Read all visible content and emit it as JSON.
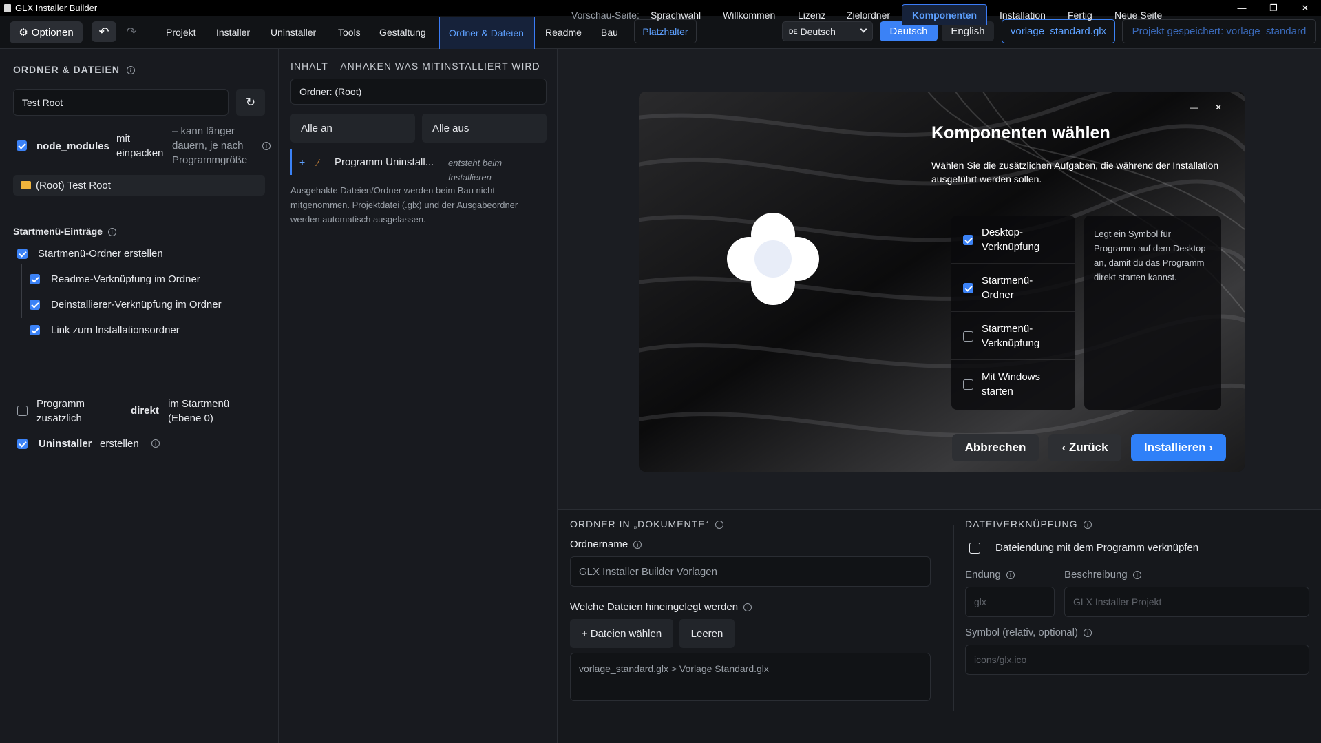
{
  "window": {
    "title": "GLX Installer Builder",
    "minimize": "—",
    "maximize": "❐",
    "close": "✕"
  },
  "toolbar": {
    "options_label": "Optionen",
    "undo": "↶",
    "redo": "↷",
    "menu": [
      "Projekt",
      "Installer",
      "Uninstaller",
      "Tools",
      "Gestaltung",
      "Ordner & Dateien",
      "Readme",
      "Bau"
    ],
    "placeholder_btn": "Platzhalter",
    "lang_select": {
      "flag": "DE",
      "value": "Deutsch"
    },
    "lang_de": "Deutsch",
    "lang_en": "English",
    "project_file": "vorlage_standard.glx",
    "saved_status": "Projekt gespeichert: vorlage_standard"
  },
  "folders": {
    "title": "ORDNER & DATEIEN",
    "root_name": "Test Root",
    "refresh": "↻",
    "node_modules": {
      "checked": true,
      "name": "node_modules",
      "suffix": "mit einpacken",
      "hint": "– kann länger dauern, je nach Programmgröße"
    },
    "tree_item": "(Root) Test Root",
    "startmenu": {
      "title": "Startmenü-Einträge",
      "create_folder": {
        "checked": true,
        "label": "Startmenü-Ordner erstellen"
      },
      "readme_link": {
        "checked": true,
        "label": "Readme-Verknüpfung im Ordner"
      },
      "uninstaller_link": {
        "checked": true,
        "label": "Deinstallierer-Verknüpfung im Ordner"
      },
      "install_link": {
        "checked": true,
        "label": "Link zum Installationsordner"
      },
      "direct": {
        "checked": false,
        "pre": "Programm zusätzlich",
        "bold": "direkt",
        "post": "im Startmenü (Ebene 0)"
      },
      "uninstaller": {
        "checked": true,
        "bold": "Uninstaller",
        "post": "erstellen"
      }
    }
  },
  "content": {
    "title": "INHALT – ANHAKEN WAS MITINSTALLIERT WIRD",
    "folder_label": "Ordner: (Root)",
    "all_on": "Alle an",
    "all_off": "Alle aus",
    "item": {
      "expand": "+",
      "name": "Programm Uninstall...",
      "note": "entsteht beim Installieren"
    },
    "footnote": "Ausgehakte Dateien/Ordner werden beim Bau nicht mitgenommen. Projektdatei (.glx) und der Ausgabeordner werden automatisch ausgelassen."
  },
  "preview_nav": {
    "label": "Vorschau-Seite:",
    "tabs": [
      "Sprachwahl",
      "Willkommen",
      "Lizenz",
      "Zielordner",
      "Komponenten",
      "Installation",
      "Fertig",
      "Neue Seite"
    ],
    "active": "Komponenten"
  },
  "dialog": {
    "minimize": "—",
    "close": "✕",
    "title": "Komponenten wählen",
    "subtitle": "Wählen Sie die zusätzlichen Aufgaben, die während der Installation ausgeführt werden sollen.",
    "options": [
      {
        "label": "Desktop-Verknüpfung",
        "checked": true
      },
      {
        "label": "Startmenü-Ordner",
        "checked": true
      },
      {
        "label": "Startmenü-Verknüpfung",
        "checked": false
      },
      {
        "label": "Mit Windows starten",
        "checked": false
      }
    ],
    "description": "Legt ein Symbol für Programm auf dem Desktop an, damit du das Programm direkt starten kannst.",
    "cancel": "Abbrechen",
    "back": "‹ Zurück",
    "install": "Installieren ›",
    "accent": "#3b82f6"
  },
  "docs_folder": {
    "title": "ORDNER IN „DOKUMENTE“",
    "name_label": "Ordnername",
    "name_placeholder": "GLX Installer Builder Vorlagen",
    "files_label": "Welche Dateien hineingelegt werden",
    "choose_files": "+ Dateien wählen",
    "clear": "Leeren",
    "files_value": "vorlage_standard.glx > Vorlage Standard.glx"
  },
  "file_assoc": {
    "title": "DATEIVERKNÜPFUNG",
    "checkbox_label": "Dateiendung mit dem Programm verknüpfen",
    "checked": false,
    "ext_label": "Endung",
    "ext_placeholder": "glx",
    "desc_label": "Beschreibung",
    "desc_placeholder": "GLX Installer Projekt",
    "icon_label": "Symbol (relativ, optional)",
    "icon_placeholder": "icons/glx.ico"
  }
}
